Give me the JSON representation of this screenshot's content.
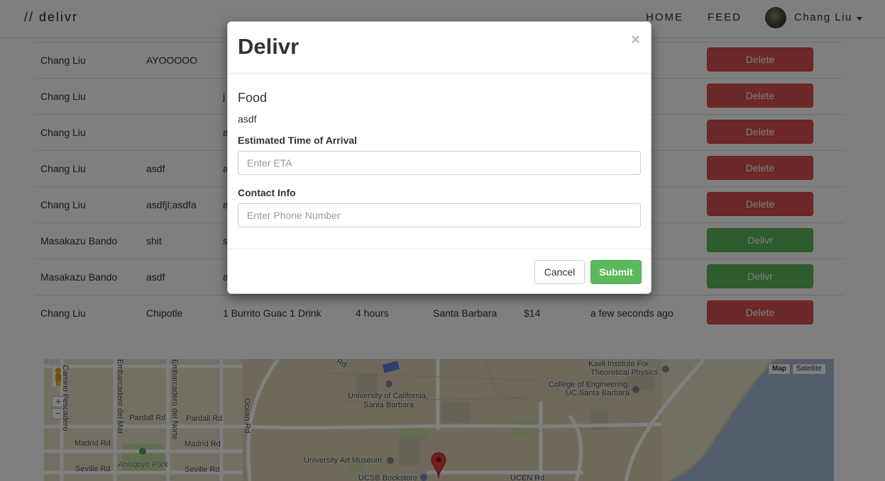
{
  "navbar": {
    "brand": "// delivr",
    "links": [
      "HOME",
      "FEED"
    ],
    "user_name": "Chang Liu"
  },
  "table": {
    "rows": [
      {
        "name": "Chang Liu",
        "food": "AYOOOOO",
        "description": "",
        "eta": "",
        "location": "",
        "price": "",
        "time": "",
        "action": "Delete"
      },
      {
        "name": "Chang Liu",
        "food": "",
        "description": "j",
        "eta": "",
        "location": "",
        "price": "",
        "time": "",
        "action": "Delete"
      },
      {
        "name": "Chang Liu",
        "food": "",
        "description": "a",
        "eta": "",
        "location": "",
        "price": "",
        "time": "",
        "action": "Delete"
      },
      {
        "name": "Chang Liu",
        "food": "asdf",
        "description": "a",
        "eta": "",
        "location": "",
        "price": "",
        "time": "",
        "action": "Delete"
      },
      {
        "name": "Chang Liu",
        "food": "asdfjl;asdfa",
        "description": "a",
        "eta": "",
        "location": "",
        "price": "",
        "time": "",
        "action": "Delete"
      },
      {
        "name": "Masakazu Bando",
        "food": "shit",
        "description": "s",
        "eta": "",
        "location": "",
        "price": "",
        "time": "",
        "action": "Delivr"
      },
      {
        "name": "Masakazu Bando",
        "food": "asdf",
        "description": "a",
        "eta": "",
        "location": "",
        "price": "",
        "time": "",
        "action": "Delivr"
      },
      {
        "name": "Chang Liu",
        "food": "Chipotle",
        "description": "1 Burrito Guac 1 Drink",
        "eta": "4 hours",
        "location": "Santa Barbara",
        "price": "$14",
        "time": "a few seconds ago",
        "action": "Delete"
      }
    ]
  },
  "map": {
    "map_type_labels": [
      "Map",
      "Satellite"
    ],
    "zoom_in": "+",
    "zoom_out": "−",
    "labels": {
      "camino_pescadero": "Camino Pescadero",
      "embarcadero_del_mar": "Embarcadero del Mar",
      "embarcadero_del_norte": "Embarcadero del Norte",
      "ocean_rd": "Ocean Rd",
      "pardall_rd_1": "Pardall Rd",
      "pardall_rd_2": "Pardall Rd",
      "madrid_rd_1": "Madrid Rd",
      "madrid_rd_2": "Madrid Rd",
      "seville_rd_1": "Seville Rd",
      "seville_rd_2": "Seville Rd",
      "anisqoyo_park": "Anisqoyo Park",
      "ucsb_1": "University of California,",
      "ucsb_2": "Santa Barbara",
      "art_museum": "University Art Museum",
      "bookstore": "UCSB Bookstore",
      "ucen_rd": "UCEN Rd",
      "kavli_1": "Kavli Institute For",
      "kavli_2": "Theoretical Physics",
      "engineering_1": "College of Engineering,",
      "engineering_2": "UC Santa Barbara",
      "road_marker": "Rd"
    }
  },
  "modal": {
    "title": "Delivr",
    "close": "×",
    "food_heading": "Food",
    "food_value": "asdf",
    "eta_label": "Estimated Time of Arrival",
    "eta_placeholder": "Enter ETA",
    "contact_label": "Contact Info",
    "contact_placeholder": "Enter Phone Number",
    "cancel_label": "Cancel",
    "submit_label": "Submit"
  },
  "colors": {
    "delete": "#d9534f",
    "delivr": "#5cb85c",
    "submit": "#5cb85c",
    "map_land": "#e8dfc7",
    "map_water": "#a4bddb",
    "map_park": "#c4dba3"
  }
}
